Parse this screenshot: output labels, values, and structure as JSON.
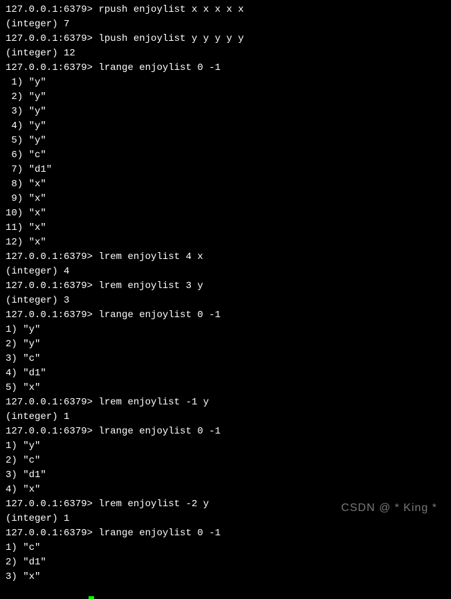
{
  "prompt": "127.0.0.1:6379>",
  "commands": [
    {
      "cmd": "rpush enjoylist x x x x x",
      "result": "(integer) 7"
    },
    {
      "cmd": "lpush enjoylist y y y y y",
      "result": "(integer) 12"
    },
    {
      "cmd": "lrange enjoylist 0 -1"
    }
  ],
  "list1": [
    " 1) \"y\"",
    " 2) \"y\"",
    " 3) \"y\"",
    " 4) \"y\"",
    " 5) \"y\"",
    " 6) \"c\"",
    " 7) \"d1\"",
    " 8) \"x\"",
    " 9) \"x\"",
    "10) \"x\"",
    "11) \"x\"",
    "12) \"x\""
  ],
  "commands2": [
    {
      "cmd": "lrem enjoylist 4 x",
      "result": "(integer) 4"
    },
    {
      "cmd": "lrem enjoylist 3 y",
      "result": "(integer) 3"
    },
    {
      "cmd": "lrange enjoylist 0 -1"
    }
  ],
  "list2": [
    "1) \"y\"",
    "2) \"y\"",
    "3) \"c\"",
    "4) \"d1\"",
    "5) \"x\""
  ],
  "commands3": [
    {
      "cmd": "lrem enjoylist -1 y",
      "result": "(integer) 1"
    },
    {
      "cmd": "lrange enjoylist 0 -1"
    }
  ],
  "list3": [
    "1) \"y\"",
    "2) \"c\"",
    "3) \"d1\"",
    "4) \"x\""
  ],
  "commands4": [
    {
      "cmd": "lrem enjoylist -2 y",
      "result": "(integer) 1"
    },
    {
      "cmd": "lrange enjoylist 0 -1"
    }
  ],
  "list4": [
    "1) \"c\"",
    "2) \"d1\"",
    "3) \"x\""
  ],
  "watermark": "CSDN @ * King *"
}
